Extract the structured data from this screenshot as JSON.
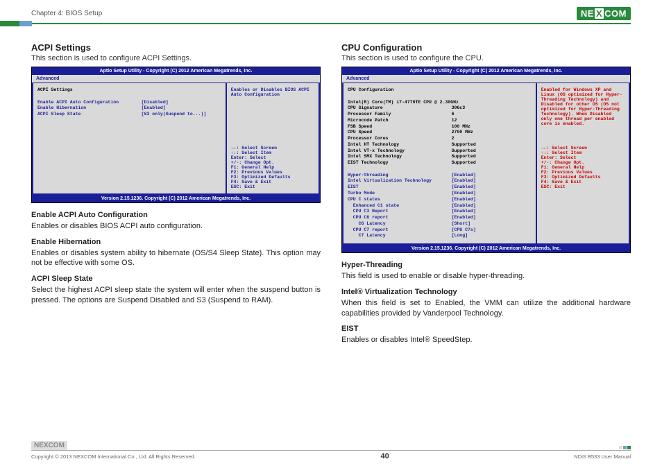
{
  "header": {
    "chapter": "Chapter 4: BIOS Setup",
    "brand_pre": "NE",
    "brand_mid": "X",
    "brand_post": "COM"
  },
  "left": {
    "title": "ACPI Settings",
    "intro": "This section is used to configure ACPI Settings.",
    "bios": {
      "top": "Aptio Setup Utility - Copyright (C) 2012 American Megatrends, Inc.",
      "tab": "Advanced",
      "heading": "ACPI Settings",
      "rows": [
        {
          "k": "Enable ACPI Auto Configuration",
          "v": "[Disabled]",
          "blue": true
        },
        {
          "k": "",
          "v": "",
          "blue": false
        },
        {
          "k": "Enable Hibernation",
          "v": "[Enabled]",
          "blue": true
        },
        {
          "k": "ACPI Sleep State",
          "v": "[S3 only(Suspend to...)]",
          "blue": true
        }
      ],
      "help_top": "Enables or Disables BIOS ACPI Auto Configuration",
      "help_keys": [
        "→←: Select Screen",
        "↑↓: Select Item",
        "Enter: Select",
        "+/-: Change Opt.",
        "F1: General Help",
        "F2: Previous Values",
        "F3: Optimized Defaults",
        "F4: Save & Exit",
        "ESC: Exit"
      ],
      "bot": "Version 2.15.1236. Copyright (C) 2012 American Megatrends, Inc."
    },
    "d1t": "Enable ACPI Auto Configuration",
    "d1p": "Enables or disables BIOS ACPI auto configuration.",
    "d2t": "Enable Hibernation",
    "d2p": "Enables or disables system ability to hibernate (OS/S4 Sleep State). This option may not be effective with some OS.",
    "d3t": "ACPI Sleep State",
    "d3p": "Select the highest ACPI sleep state the system will enter when the suspend button is pressed. The options are Suspend Disabled and S3 (Suspend to RAM)."
  },
  "right": {
    "title": "CPU Configuration",
    "intro": "This section is used to configure the CPU.",
    "bios": {
      "top": "Aptio Setup Utility - Copyright (C) 2012 American Megatrends, Inc.",
      "tab": "Advanced",
      "heading": "CPU Configuration",
      "info": [
        {
          "k": "Intel(R) Core(TM) i7-4770TE CPU @ 2.30GHz",
          "v": ""
        },
        {
          "k": "CPU Signature",
          "v": "306c3"
        },
        {
          "k": "Processor Family",
          "v": "6"
        },
        {
          "k": "Microcode Patch",
          "v": "12"
        },
        {
          "k": "FSB Speed",
          "v": "100 MHz"
        },
        {
          "k": "CPU Speed",
          "v": "2700 MHz"
        },
        {
          "k": "Processor Cores",
          "v": "2"
        },
        {
          "k": "Intel HT Technology",
          "v": "Supported"
        },
        {
          "k": "Intel VT-x Technology",
          "v": "Supported"
        },
        {
          "k": "Intel SMX Technology",
          "v": "Supported"
        },
        {
          "k": "EIST Technology",
          "v": "Supported"
        }
      ],
      "opts": [
        {
          "k": "Hyper-threading",
          "v": "[Enabled]"
        },
        {
          "k": "Intel Virtualization Technology",
          "v": "[Enabled]"
        },
        {
          "k": "EIST",
          "v": "[Enabled]"
        },
        {
          "k": "Turbo Mode",
          "v": "[Enabled]"
        },
        {
          "k": "CPU C states",
          "v": "[Enabled]"
        },
        {
          "k": "  Enhanced C1 state",
          "v": "[Enabled]"
        },
        {
          "k": "  CPU C3 Report",
          "v": "[Enabled]"
        },
        {
          "k": "  CPU C6 report",
          "v": "[Enabled]"
        },
        {
          "k": "    C6 Latency",
          "v": "[Short]"
        },
        {
          "k": "  CPU C7 report",
          "v": "[CPU C7s]"
        },
        {
          "k": "    C7 Latency",
          "v": "[Long]"
        }
      ],
      "help_top": "Enabled for Windows XP and Linux (OS optimized for Hyper-Threading Technology) and Disabled for other OS (OS not optimized for Hyper-Threading Technology). When Disabled only one thread per enabled core is enabled.",
      "help_keys": [
        "→←: Select Screen",
        "↑↓: Select Item",
        "Enter: Select",
        "+/-: Change Opt.",
        "F1: General Help",
        "F2: Previous Values",
        "F3: Optimized Defaults",
        "F4: Save & Exit",
        "ESC: Exit"
      ],
      "bot": "Version 2.15.1236. Copyright (C) 2012 American Megatrends, Inc."
    },
    "d1t": "Hyper-Threading",
    "d1p": "This field is used to enable or disable hyper-threading.",
    "d2t": "Intel® Virtualization Technology",
    "d2p": "When this field is set to Enabled, the VMM can utilize the additional hardware capabilities provided by Vanderpool Technology.",
    "d3t": "EIST",
    "d3p": "Enables or disables Intel® SpeedStep."
  },
  "footer": {
    "copyright": "Copyright © 2013 NEXCOM International Co., Ltd. All Rights Reserved.",
    "page": "40",
    "doc": "NDiS B533 User Manual"
  }
}
